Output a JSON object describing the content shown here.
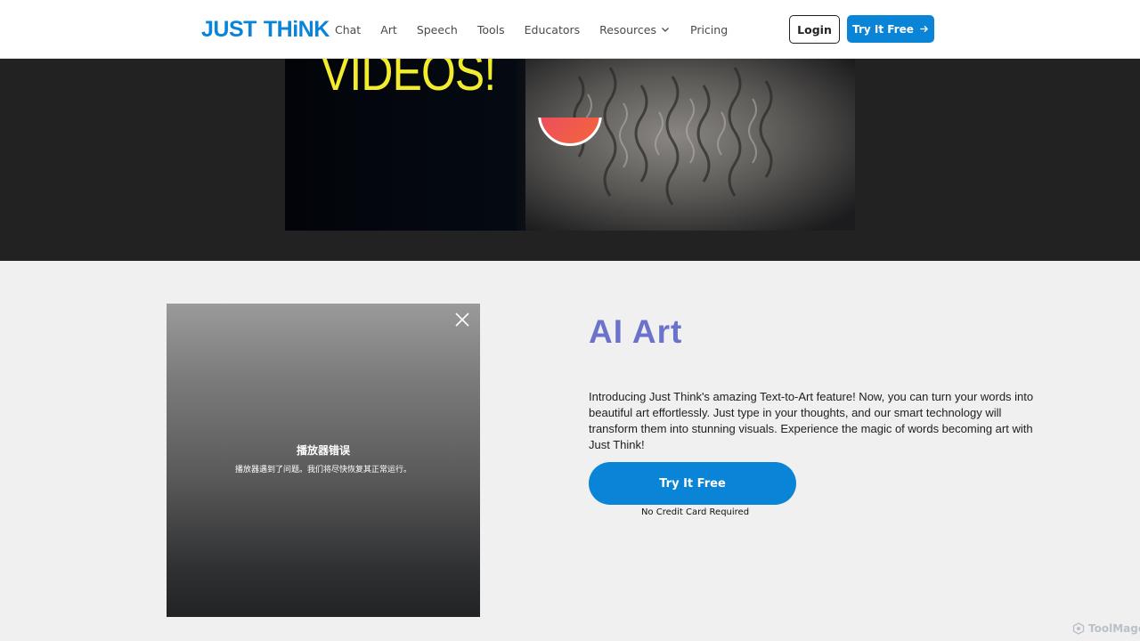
{
  "header": {
    "logo_part1": "JUST",
    "logo_part2": "THiNK",
    "nav": [
      {
        "label": "Chat"
      },
      {
        "label": "Art"
      },
      {
        "label": "Speech"
      },
      {
        "label": "Tools"
      },
      {
        "label": "Educators"
      },
      {
        "label": "Resources",
        "icon": "chevron-down-icon"
      },
      {
        "label": "Pricing"
      }
    ],
    "login_label": "Login",
    "try_label": "Try It Free",
    "try_icon": "arrow-right-icon"
  },
  "video": {
    "title_text": "VIDEOS!",
    "play_icon": "play-icon"
  },
  "player_error": {
    "close_icon": "close-icon",
    "title": "播放器错误",
    "message": "播放器遇到了问题。我们将尽快恢复其正常运行。"
  },
  "feature": {
    "title": "AI Art",
    "description": "Introducing Just Think's amazing Text-to-Art feature! Now, you can turn your words into beautiful art effortlessly. Just type in your thoughts, and our smart technology will transform them into stunning visuals. Experience the magic of words becoming art with Just Think!",
    "cta_label": "Try It Free",
    "cta_note": "No Credit Card Required"
  },
  "watermark": {
    "text": "ToolMage",
    "icon": "toolmage-logo-icon"
  },
  "colors": {
    "brand_blue": "#0a84d6",
    "title_purple": "#6a72cc",
    "video_text_yellow": "#f3ec2c"
  }
}
